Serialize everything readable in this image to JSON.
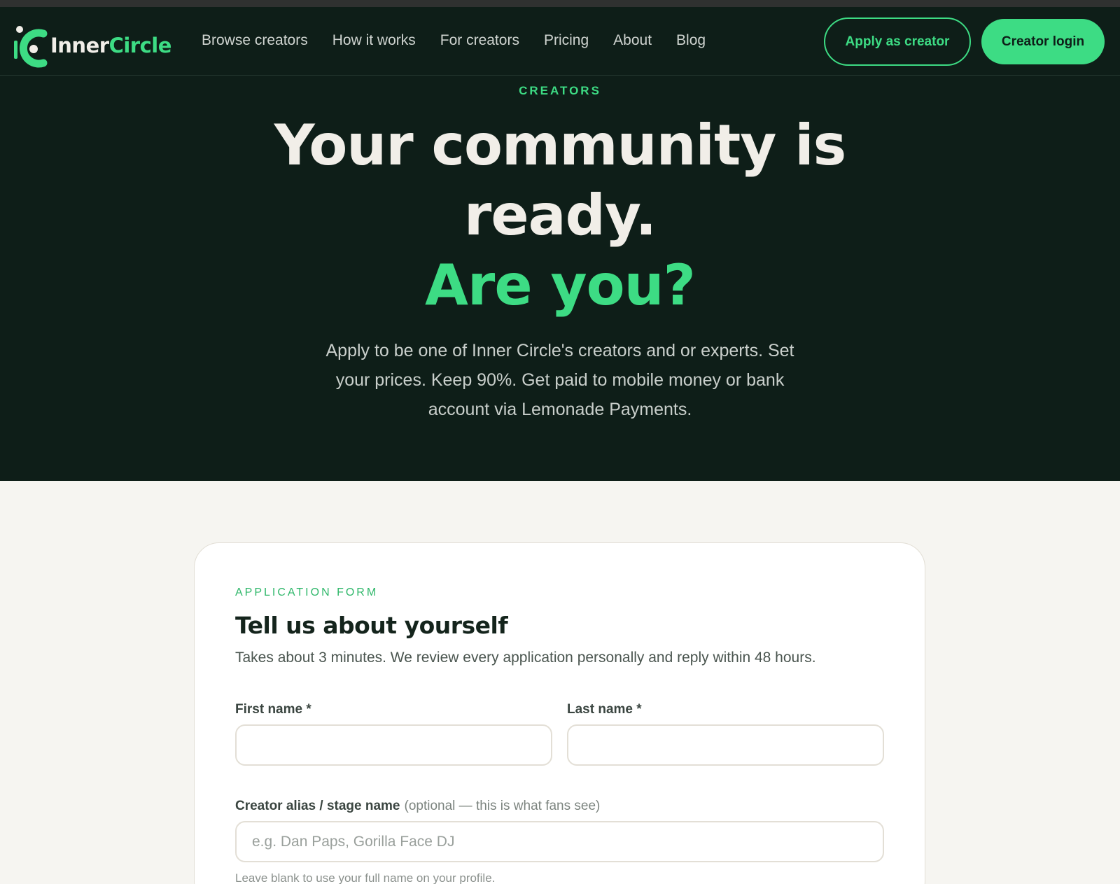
{
  "brand": {
    "name_part1": "Inner",
    "name_part2": "Circle",
    "accent_color": "#3ddc84",
    "dark_bg": "#0e1e18"
  },
  "nav": {
    "items": [
      {
        "label": "Browse creators"
      },
      {
        "label": "How it works"
      },
      {
        "label": "For creators"
      },
      {
        "label": "Pricing"
      },
      {
        "label": "About"
      },
      {
        "label": "Blog"
      }
    ],
    "apply_label": "Apply as creator",
    "login_label": "Creator login"
  },
  "hero": {
    "eyebrow": "CREATORS",
    "title_line1": "Your community is",
    "title_line2": "ready.",
    "title_accent": "Are you?",
    "subtitle": "Apply to be one of Inner Circle's creators and or experts. Set your prices. Keep 90%. Get paid to mobile money or bank account via Lemonade Payments."
  },
  "form": {
    "eyebrow": "APPLICATION FORM",
    "title": "Tell us about yourself",
    "subtitle": "Takes about 3 minutes. We review every application personally and reply within 48 hours.",
    "first_name_label": "First name *",
    "first_name_value": "",
    "last_name_label": "Last name *",
    "last_name_value": "",
    "alias_label": "Creator alias / stage name",
    "alias_hint": "(optional — this is what fans see)",
    "alias_placeholder": "e.g. Dan Paps, Gorilla Face DJ",
    "alias_value": "",
    "alias_help": "Leave blank to use your full name on your profile."
  }
}
